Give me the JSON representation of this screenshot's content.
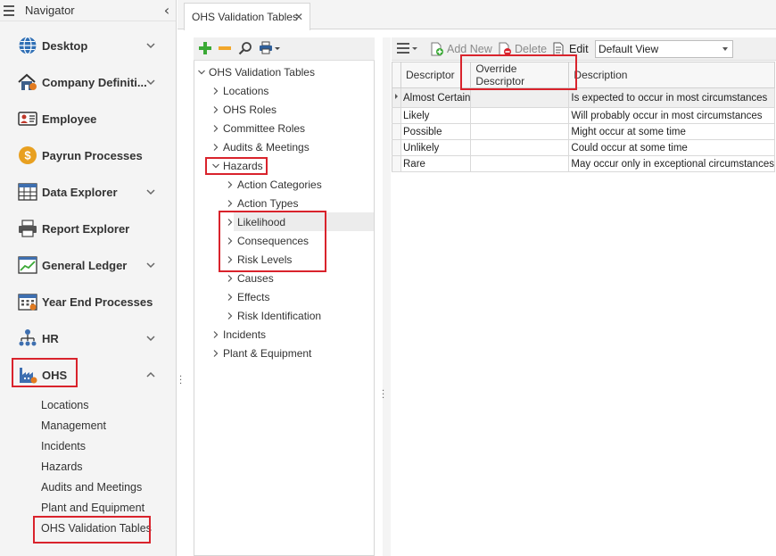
{
  "navigator": {
    "title": "Navigator",
    "items": [
      {
        "label": "Desktop",
        "icon": "globe-icon"
      },
      {
        "label": "Company Definiti...",
        "icon": "company-house-icon"
      },
      {
        "label": "Employee",
        "icon": "employee-card-icon"
      },
      {
        "label": "Payrun Processes",
        "icon": "dollar-coin-icon"
      },
      {
        "label": "Data Explorer",
        "icon": "table-grid-icon"
      },
      {
        "label": "Report Explorer",
        "icon": "printer-icon"
      },
      {
        "label": "General Ledger",
        "icon": "ledger-chart-icon"
      },
      {
        "label": "Year End Processes",
        "icon": "calendar-icon"
      },
      {
        "label": "HR",
        "icon": "org-chart-icon"
      },
      {
        "label": "OHS",
        "icon": "factory-icon"
      }
    ],
    "ohs_subitems": [
      "Locations",
      "Management",
      "Incidents",
      "Hazards",
      "Audits and Meetings",
      "Plant and Equipment",
      "OHS Validation Tables"
    ]
  },
  "tab": {
    "label": "OHS Validation Tables",
    "close": "✕"
  },
  "tree": {
    "root": "OHS Validation Tables",
    "top_items": [
      "Locations",
      "OHS Roles",
      "Committee Roles",
      "Audits & Meetings"
    ],
    "hazards": "Hazards",
    "hazard_children": [
      "Action Categories",
      "Action Types",
      "Likelihood",
      "Consequences",
      "Risk Levels",
      "Causes",
      "Effects",
      "Risk Identification"
    ],
    "bottom_items": [
      "Incidents",
      "Plant & Equipment"
    ]
  },
  "grid_toolbar": {
    "add_new": "Add New",
    "delete": "Delete",
    "edit": "Edit",
    "view": "Default View"
  },
  "grid": {
    "columns": [
      "Descriptor",
      "Override Descriptor",
      "Description"
    ],
    "rows": [
      {
        "descriptor": "Almost Certain",
        "override": "",
        "description": "Is expected to occur in most circumstances"
      },
      {
        "descriptor": "Likely",
        "override": "",
        "description": "Will probably occur in most circumstances"
      },
      {
        "descriptor": "Possible",
        "override": "",
        "description": "Might occur at some time"
      },
      {
        "descriptor": "Unlikely",
        "override": "",
        "description": "Could occur at some time"
      },
      {
        "descriptor": "Rare",
        "override": "",
        "description": "May occur only in exceptional circumstances"
      }
    ]
  },
  "colors": {
    "highlight_red": "#d9232c",
    "add_green": "#3aa935",
    "remove_orange": "#f2a72b"
  }
}
